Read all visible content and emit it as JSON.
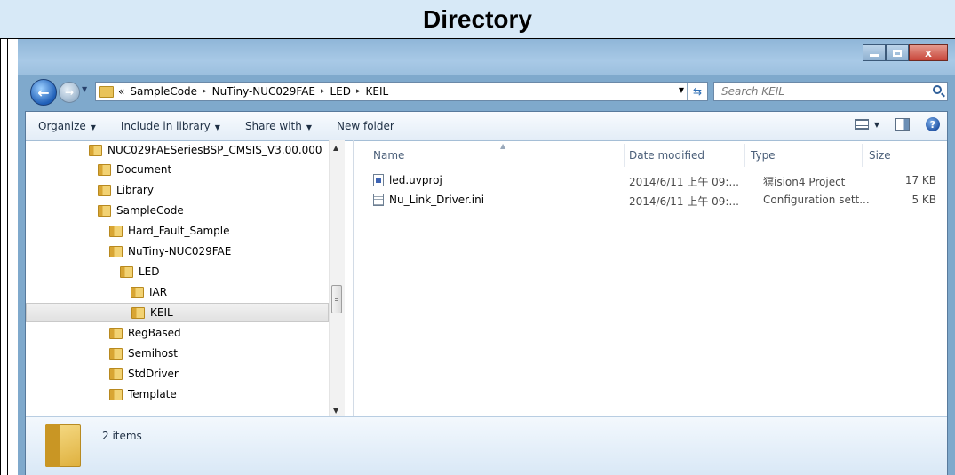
{
  "header": {
    "title": "Directory"
  },
  "window": {
    "controls": {
      "minimize": "–",
      "maximize": "□",
      "close": "x"
    }
  },
  "address": {
    "crumbs": [
      "«",
      "SampleCode",
      "NuTiny-NUC029FAE",
      "LED",
      "KEIL"
    ],
    "separator": "▸"
  },
  "search": {
    "placeholder": "Search KEIL"
  },
  "toolbar": {
    "organize": "Organize",
    "include_in_library": "Include in library",
    "share_with": "Share with",
    "new_folder": "New folder"
  },
  "tree": {
    "items": [
      {
        "label": "NUC029FAESeriesBSP_CMSIS_V3.00.000",
        "level": 0
      },
      {
        "label": "Document",
        "level": 1
      },
      {
        "label": "Library",
        "level": 1
      },
      {
        "label": "SampleCode",
        "level": 1
      },
      {
        "label": "Hard_Fault_Sample",
        "level": 2
      },
      {
        "label": "NuTiny-NUC029FAE",
        "level": 2
      },
      {
        "label": "LED",
        "level": 3
      },
      {
        "label": "IAR",
        "level": 4
      },
      {
        "label": "KEIL",
        "level": 4,
        "selected": true
      },
      {
        "label": "RegBased",
        "level": 2
      },
      {
        "label": "Semihost",
        "level": 2
      },
      {
        "label": "StdDriver",
        "level": 2
      },
      {
        "label": "Template",
        "level": 2
      }
    ]
  },
  "list": {
    "columns": [
      "Name",
      "Date modified",
      "Type",
      "Size"
    ],
    "rows": [
      {
        "name": "led.uvproj",
        "date": "2014/6/11 上午 09:...",
        "type": "猽ision4 Project",
        "size": "17 KB",
        "icon": "uvproj-file-icon"
      },
      {
        "name": "Nu_Link_Driver.ini",
        "date": "2014/6/11 上午 09:...",
        "type": "Configuration sett...",
        "size": "5 KB",
        "icon": "ini-file-icon"
      }
    ]
  },
  "status": {
    "items": "2 items"
  },
  "colors": {
    "title_band": "#d7e9f7",
    "frame": "#7fa9cc",
    "selected_row": "#e5e5e5"
  }
}
